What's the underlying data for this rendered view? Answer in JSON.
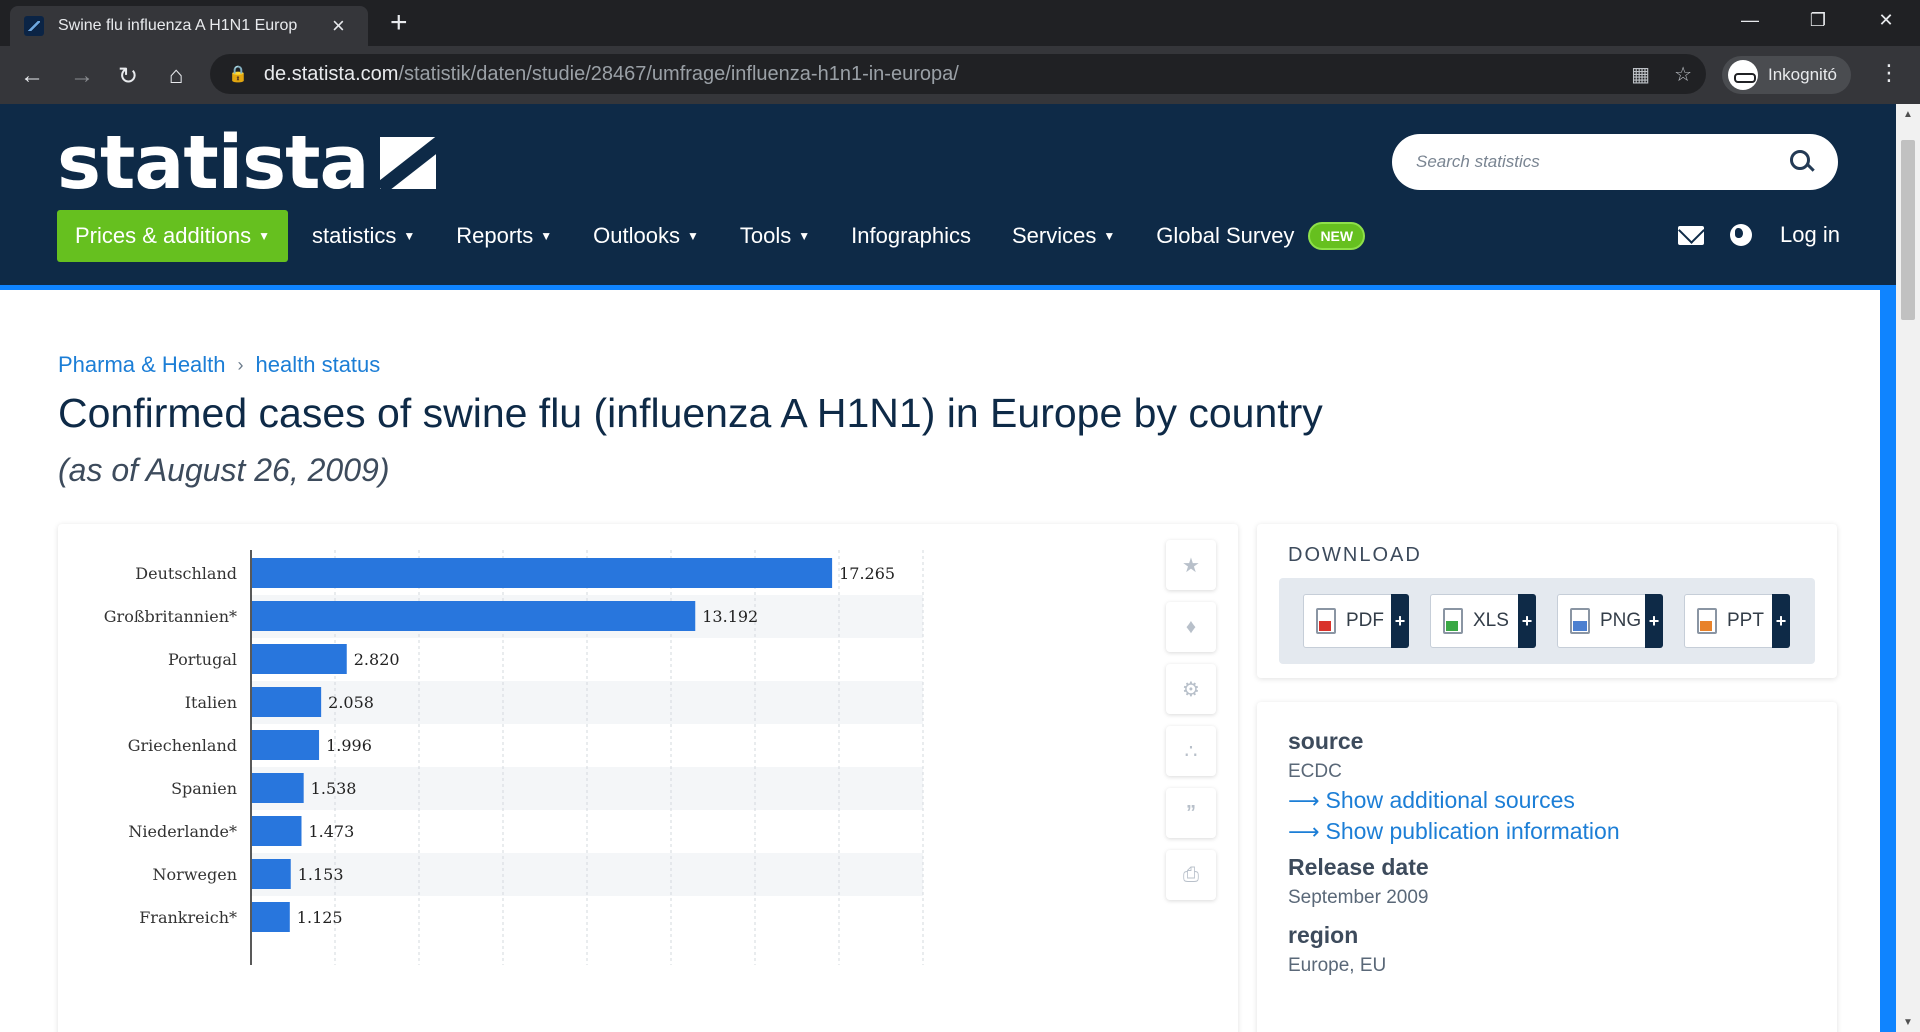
{
  "browser": {
    "tab_title": "Swine flu influenza A H1N1 Europ",
    "url_host": "de.statista.com",
    "url_path": "/statistik/daten/studie/28467/umfrage/influenza-h1n1-in-europa/",
    "profile_label": "Inkognitó"
  },
  "header": {
    "logo_text": "statista",
    "search_placeholder": "Search statistics",
    "nav": [
      {
        "label": "Prices & additions",
        "caret": true
      },
      {
        "label": "statistics",
        "caret": true
      },
      {
        "label": "Reports",
        "caret": true
      },
      {
        "label": "Outlooks",
        "caret": true
      },
      {
        "label": "Tools",
        "caret": true
      },
      {
        "label": "Infographics",
        "caret": false
      },
      {
        "label": "Services",
        "caret": true
      },
      {
        "label": "Global Survey",
        "caret": false
      }
    ],
    "new_badge": "NEW",
    "login_label": "Log in"
  },
  "breadcrumb": [
    "Pharma & Health",
    "health status"
  ],
  "page": {
    "title": "Confirmed cases of swine flu (influenza A H1N1) in Europe by country",
    "subtitle": "(as of August 26, 2009)"
  },
  "chart_data": {
    "type": "bar",
    "orientation": "horizontal",
    "categories": [
      "Deutschland",
      "Großbritannien*",
      "Portugal",
      "Italien",
      "Griechenland",
      "Spanien",
      "Niederlande*",
      "Norwegen",
      "Frankreich*"
    ],
    "values": [
      17265,
      13192,
      2820,
      2058,
      1996,
      1538,
      1473,
      1153,
      1125
    ],
    "value_labels": [
      "17.265",
      "13.192",
      "2.820",
      "2.058",
      "1.996",
      "1.538",
      "1.473",
      "1.153",
      "1.125"
    ],
    "xlim": [
      0,
      20000
    ],
    "grid": true,
    "bar_color": "#2876dd"
  },
  "download": {
    "heading": "DOWNLOAD",
    "formats": [
      "PDF",
      "XLS",
      "PNG",
      "PPT"
    ]
  },
  "info": {
    "source_heading": "source",
    "source_value": "ECDC",
    "link_sources": "Show additional sources",
    "link_publication": "Show publication information",
    "release_heading": "Release date",
    "release_value": "September 2009",
    "region_heading": "region",
    "region_value": "Europe, EU"
  },
  "colors": {
    "header_bg": "#0e2a47",
    "accent_green": "#66c01f",
    "link_blue": "#1c7ed6",
    "accent_blue": "#0f84ff"
  }
}
